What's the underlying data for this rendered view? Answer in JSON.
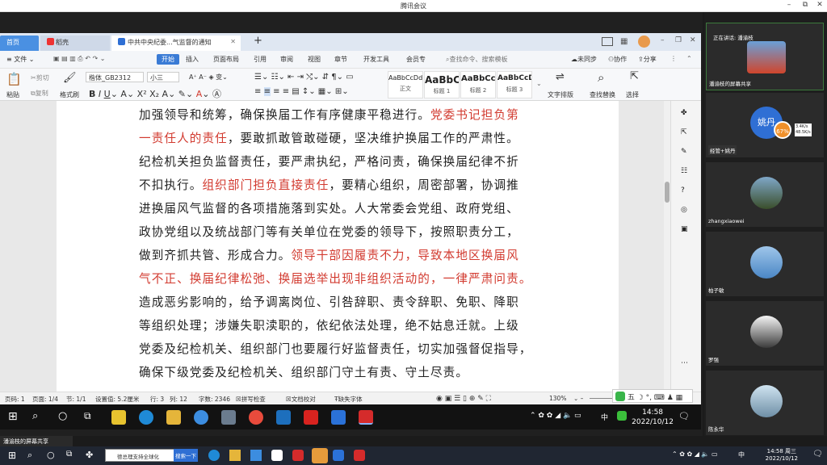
{
  "meeting": {
    "window_title": "腾讯会议",
    "share_label": "潘渝枝的屏幕共享",
    "participants": [
      {
        "name": "潘渝枝的屏幕共享",
        "speaking": "正在讲话: 潘渝枝"
      },
      {
        "name": "经管+姚丹",
        "avatar_text": "姚丹",
        "badge": "67%",
        "net_up": "3.4K/s",
        "net_down": "48.5K/s"
      },
      {
        "name": "zhangxiaowei"
      },
      {
        "name": "柏子敏"
      },
      {
        "name": "罗强"
      },
      {
        "name": "陈永华"
      }
    ]
  },
  "wps": {
    "tabs": {
      "home": "首页",
      "daoke": "稻壳",
      "doc": "中共中央纪委...气监督的通知"
    },
    "menu": [
      "文件",
      "开始",
      "插入",
      "页面布局",
      "引用",
      "审阅",
      "视图",
      "章节",
      "开发工具",
      "会员专"
    ],
    "menu_search": "查找命令、搜索模板",
    "menu_right": {
      "sync": "未同步",
      "collab": "协作",
      "share": "分享"
    },
    "ribbon": {
      "paste": "粘贴",
      "cut": "剪切",
      "copy": "复制",
      "format_painter": "格式刷",
      "font": "楷体_GB2312",
      "size": "小三",
      "styles": [
        {
          "sample": "AaBbCcDd",
          "name": "正文"
        },
        {
          "sample": "AaBbC",
          "name": "标题 1"
        },
        {
          "sample": "AaBbCc",
          "name": "标题 2"
        },
        {
          "sample": "AaBbCcD",
          "name": "标题 3"
        }
      ],
      "text_layout": "文字排版",
      "find_replace": "查找替换",
      "select": "选择"
    },
    "document_lines": [
      [
        {
          "t": "加强领导和统筹，确保换届工作有序健康平稳进行。",
          "red": false
        },
        {
          "t": "党委书记担负第",
          "red": true
        }
      ],
      [
        {
          "t": "一责任人的责任",
          "red": true
        },
        {
          "t": "，要敢抓敢管敢碰硬，坚决维护换届工作的严肃性。",
          "red": false
        }
      ],
      [
        {
          "t": "纪检机关担负监督责任，要严肃执纪，严格问责，确保换届纪律不折",
          "red": false
        }
      ],
      [
        {
          "t": "不扣执行。",
          "red": false
        },
        {
          "t": "组织部门担负直接责任",
          "red": true
        },
        {
          "t": "，要精心组织，周密部署，协调推",
          "red": false
        }
      ],
      [
        {
          "t": "进换届风气监督的各项措施落到实处。人大常委会党组、政府党组、",
          "red": false
        }
      ],
      [
        {
          "t": "政协党组以及统战部门等有关单位在党委的领导下，按照职责分工，",
          "red": false
        }
      ],
      [
        {
          "t": "做到齐抓共管、形成合力。",
          "red": false
        },
        {
          "t": "领导干部因履责不力，导致本地区换届风",
          "red": true
        }
      ],
      [
        {
          "t": "气不正、换届纪律松弛、换届选举出现非组织活动的，一律严肃问责。",
          "red": true
        }
      ],
      [
        {
          "t": "造成恶劣影响的，给予调离岗位、引咎辞职、责令辞职、免职、降职",
          "red": false
        }
      ],
      [
        {
          "t": "等组织处理；涉嫌失职渎职的，依纪依法处理，绝不姑息迁就。上级",
          "red": false
        }
      ],
      [
        {
          "t": "党委及纪检机关、组织部门也要履行好监督责任，切实加强督促指导，",
          "red": false
        }
      ],
      [
        {
          "t": "确保下级党委及纪检机关、组织部门守土有责、守土尽责。",
          "red": false
        }
      ]
    ],
    "status": {
      "page": "页码: 1",
      "pages": "页面: 1/4",
      "section": "节: 1/1",
      "setting": "设置值: 5.2厘米",
      "row": "行: 3",
      "col": "列: 12",
      "words": "字数: 2346",
      "spell": "拼写检查",
      "proof": "文档校对",
      "missing_font": "缺失字体",
      "zoom": "130%"
    },
    "inner_clock": {
      "time": "14:58",
      "date": "2022/10/12",
      "ime": "中"
    }
  },
  "outer_taskbar": {
    "search_text": "德总理支持全球化",
    "search_button": "搜索一下",
    "clock_time": "14:58 周三",
    "clock_date": "2022/10/12",
    "ime": "中"
  }
}
